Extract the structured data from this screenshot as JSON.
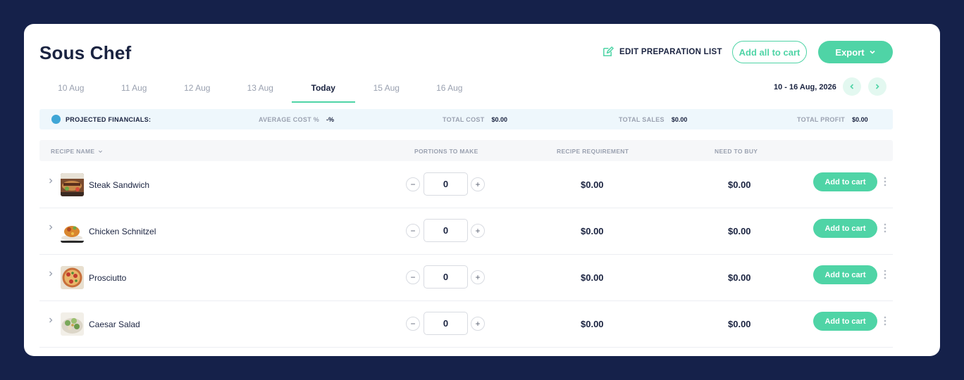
{
  "header": {
    "title": "Sous Chef",
    "edit_label": "EDIT PREPARATION LIST",
    "add_all_label": "Add all to cart",
    "export_label": "Export"
  },
  "tabs": [
    {
      "label": "10 Aug",
      "active": false
    },
    {
      "label": "11 Aug",
      "active": false
    },
    {
      "label": "12 Aug",
      "active": false
    },
    {
      "label": "13 Aug",
      "active": false
    },
    {
      "label": "Today",
      "active": true
    },
    {
      "label": "15 Aug",
      "active": false
    },
    {
      "label": "16 Aug",
      "active": false
    }
  ],
  "date_range": "10 - 16 Aug, 2026",
  "financials": {
    "title": "PROJECTED FINANCIALS:",
    "avg_cost_label": "AVERAGE COST %",
    "avg_cost_value": "-%",
    "total_cost_label": "TOTAL COST",
    "total_cost_value": "$0.00",
    "total_sales_label": "TOTAL SALES",
    "total_sales_value": "$0.00",
    "total_profit_label": "TOTAL PROFIT",
    "total_profit_value": "$0.00"
  },
  "table": {
    "columns": [
      "RECIPE NAME",
      "PORTIONS TO MAKE",
      "RECIPE REQUIREMENT",
      "NEED TO BUY"
    ],
    "add_label": "Add to cart",
    "rows": [
      {
        "name": "Steak Sandwich",
        "portions": "0",
        "requirement": "$0.00",
        "need": "$0.00"
      },
      {
        "name": "Chicken Schnitzel",
        "portions": "0",
        "requirement": "$0.00",
        "need": "$0.00"
      },
      {
        "name": "Prosciutto",
        "portions": "0",
        "requirement": "$0.00",
        "need": "$0.00"
      },
      {
        "name": "Caesar Salad",
        "portions": "0",
        "requirement": "$0.00",
        "need": "$0.00"
      }
    ]
  },
  "colors": {
    "background": "#15214a",
    "accent": "#4fd4a6",
    "text": "#1a2340",
    "muted": "#9aa1b0",
    "financials_bg": "#eef7fc"
  }
}
